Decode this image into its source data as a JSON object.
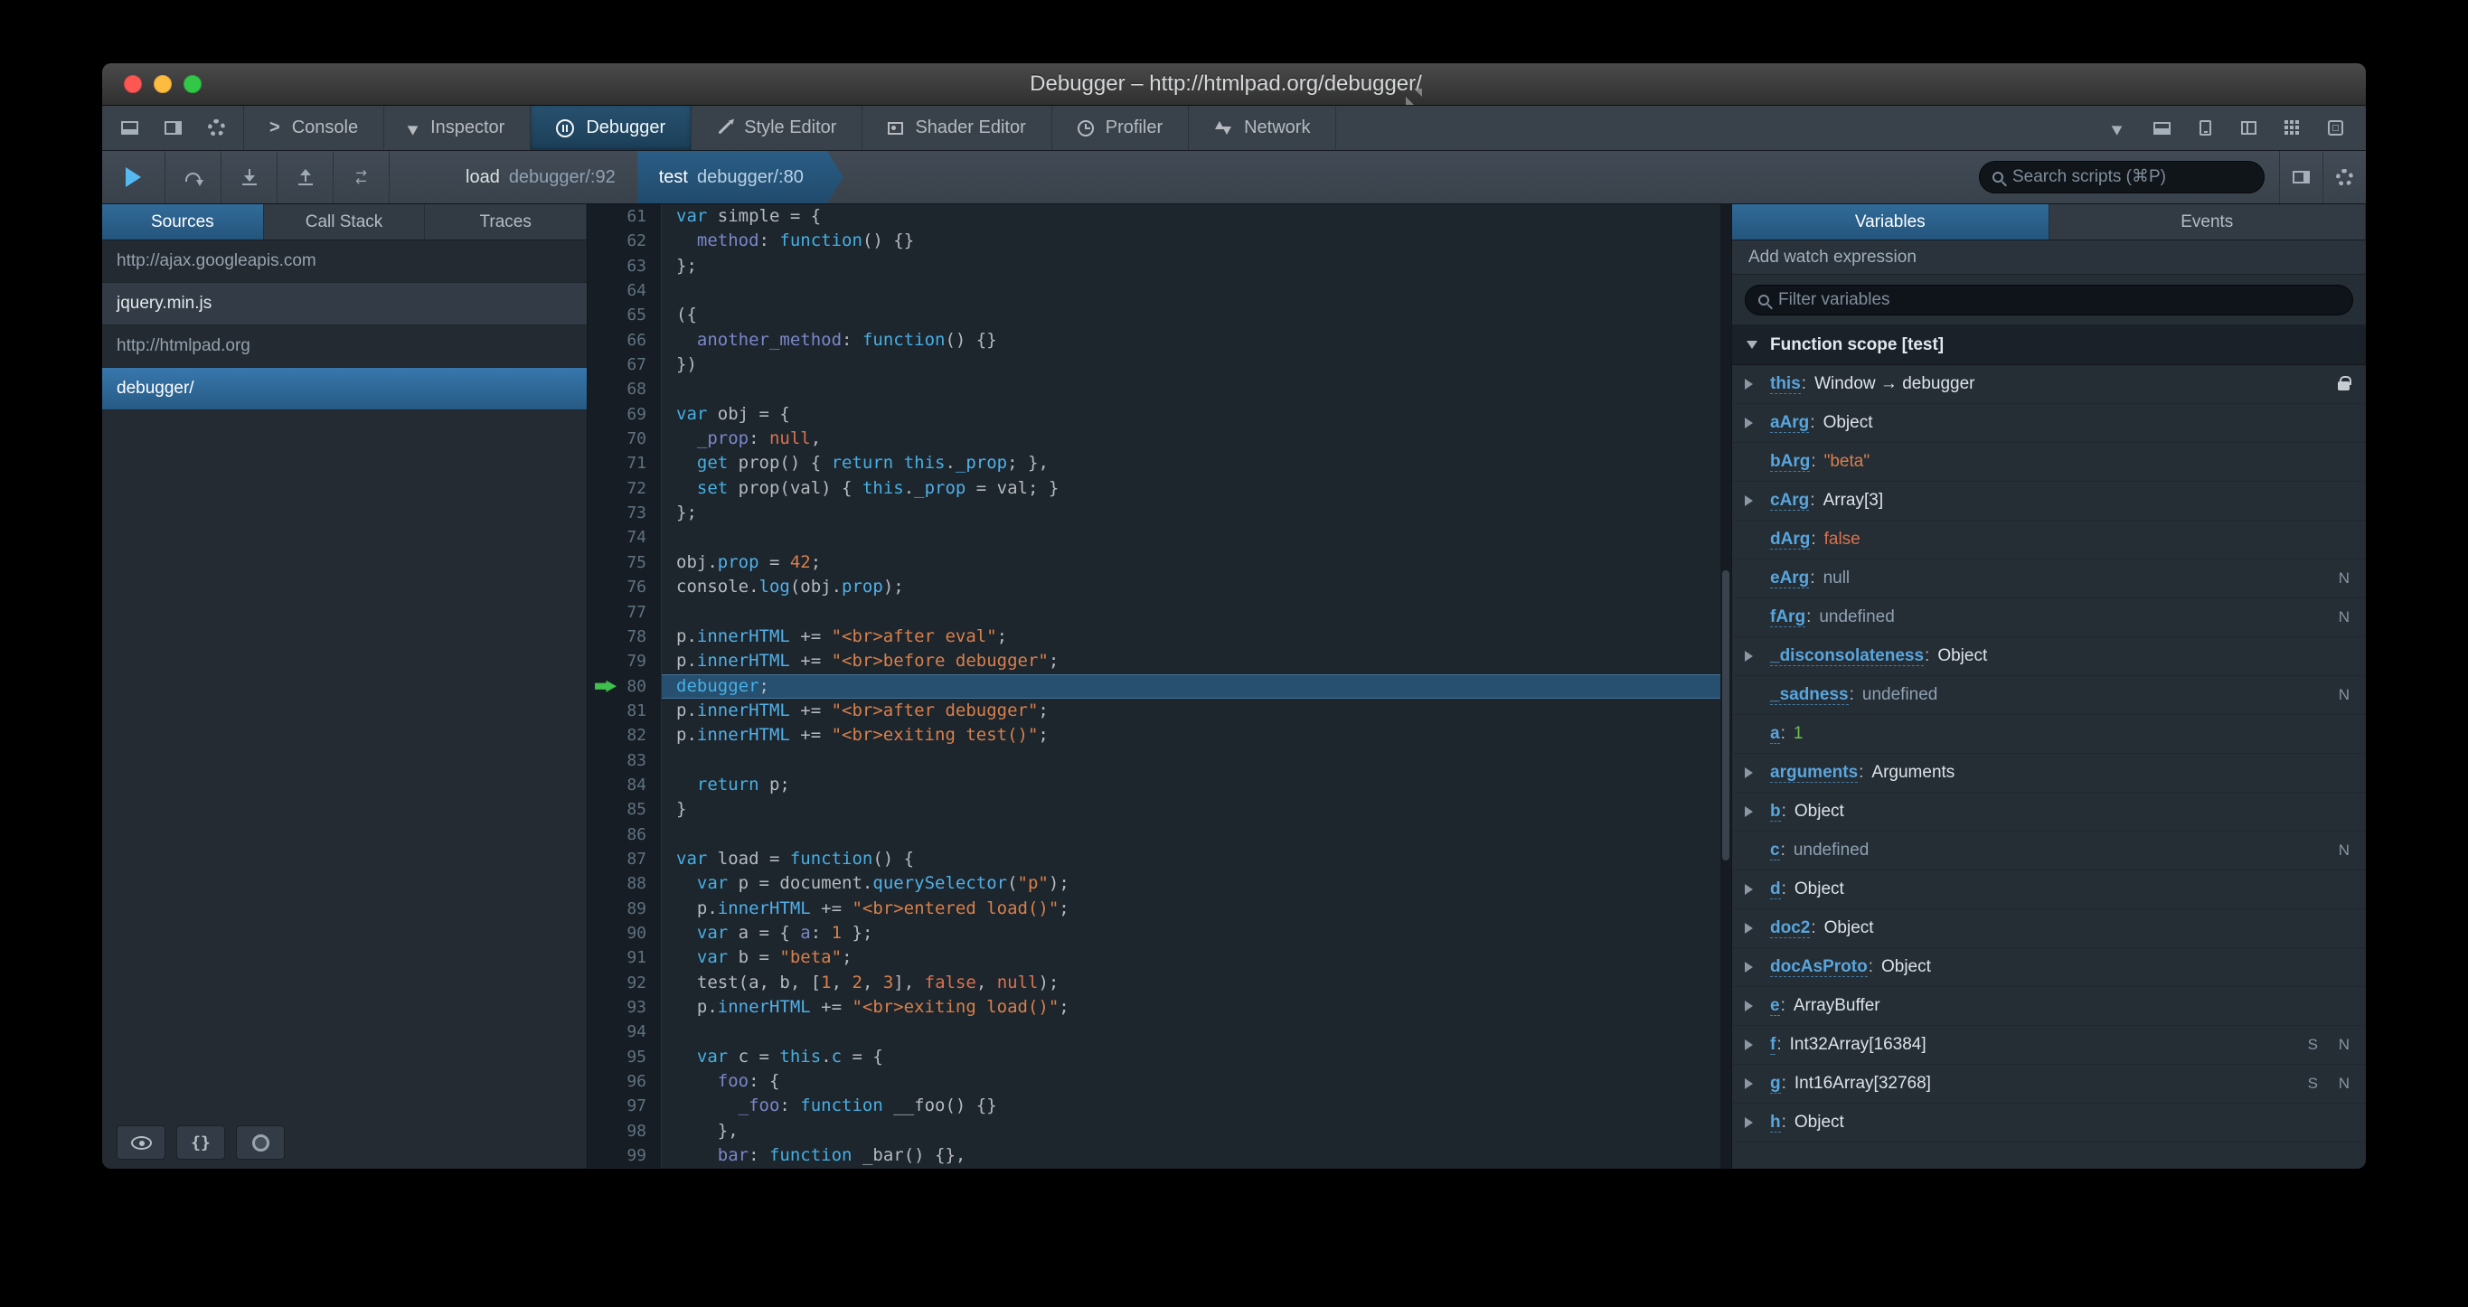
{
  "window": {
    "title": "Debugger – http://htmlpad.org/debugger/"
  },
  "colors": {
    "accent_blue": "#46afe3",
    "selection_blue": "#1d4f73",
    "exec_arrow_green": "#3fbf4e",
    "string_orange": "#d9804a"
  },
  "toolbox": {
    "left_icons": [
      {
        "button": "dock-bottom-button",
        "icon": "dock-bottom"
      },
      {
        "button": "dock-side-button",
        "icon": "dock-side"
      },
      {
        "button": "toolbox-options-button",
        "icon": "gear"
      }
    ],
    "tabs": [
      {
        "label": "Console",
        "icon": "console"
      },
      {
        "label": "Inspector",
        "icon": "inspector"
      },
      {
        "label": "Debugger",
        "icon": "debugger"
      },
      {
        "label": "Style Editor",
        "icon": "style"
      },
      {
        "label": "Shader Editor",
        "icon": "shader"
      },
      {
        "label": "Profiler",
        "icon": "profiler"
      },
      {
        "label": "Network",
        "icon": "network"
      }
    ],
    "active_tab": "Debugger",
    "right_icons": [
      {
        "button": "pick-element-button",
        "icon": "pick-element"
      },
      {
        "button": "split-console-button",
        "icon": "split-console"
      },
      {
        "button": "responsive-mode-button",
        "icon": "responsive-mode"
      },
      {
        "button": "scratchpad-button",
        "icon": "scratchpad"
      },
      {
        "button": "grid-button",
        "icon": "grid"
      },
      {
        "button": "frame-button",
        "icon": "frame"
      }
    ]
  },
  "debugger_toolbar": {
    "left_buttons": [
      {
        "button": "resume-button",
        "icon": "resume"
      },
      {
        "button": "step-over-button",
        "icon": "step-over"
      },
      {
        "button": "step-in-button",
        "icon": "step-in"
      },
      {
        "button": "step-out-button",
        "icon": "step-out"
      },
      {
        "button": "trace-button",
        "icon": "trace"
      }
    ],
    "crumbs": [
      {
        "fn": "load",
        "loc": "debugger/:92",
        "selected": false
      },
      {
        "fn": "test",
        "loc": "debugger/:80",
        "selected": true
      }
    ],
    "search_placeholder": "Search scripts (⌘P)",
    "right_icons": [
      {
        "button": "toggle-panes-button",
        "icon": "toggle-panes"
      },
      {
        "button": "debugger-options-button",
        "icon": "gear"
      }
    ]
  },
  "sources_panel": {
    "tabs": [
      "Sources",
      "Call Stack",
      "Traces"
    ],
    "active_tab": "Sources",
    "items": [
      {
        "label": "http://ajax.googleapis.com",
        "type": "group",
        "selected": false
      },
      {
        "label": "jquery.min.js",
        "type": "file",
        "selected": false
      },
      {
        "label": "http://htmlpad.org",
        "type": "group",
        "selected": false
      },
      {
        "label": "debugger/",
        "type": "file",
        "selected": true
      }
    ],
    "footer_buttons": [
      {
        "button": "toggle-source-visibility-button",
        "icon": "eye"
      },
      {
        "button": "pretty-print-button",
        "icon": "braces"
      },
      {
        "button": "blackbox-source-button",
        "icon": "blackbox"
      }
    ]
  },
  "editor": {
    "current_line": 80,
    "lines": [
      {
        "n": 61,
        "t": [
          [
            "k",
            "var"
          ],
          [
            "d",
            " simple = {"
          ]
        ]
      },
      {
        "n": 62,
        "t": [
          [
            "d",
            "  "
          ],
          [
            "p",
            "method"
          ],
          [
            "d",
            ": "
          ],
          [
            "k",
            "function"
          ],
          [
            "d",
            "() {}"
          ]
        ]
      },
      {
        "n": 63,
        "t": [
          [
            "d",
            "};"
          ]
        ]
      },
      {
        "n": 64,
        "t": []
      },
      {
        "n": 65,
        "t": [
          [
            "d",
            "({"
          ]
        ]
      },
      {
        "n": 66,
        "t": [
          [
            "d",
            "  "
          ],
          [
            "p",
            "another_method"
          ],
          [
            "d",
            ": "
          ],
          [
            "k",
            "function"
          ],
          [
            "d",
            "() {}"
          ]
        ]
      },
      {
        "n": 67,
        "t": [
          [
            "d",
            "})"
          ]
        ]
      },
      {
        "n": 68,
        "t": []
      },
      {
        "n": 69,
        "t": [
          [
            "k",
            "var"
          ],
          [
            "d",
            " obj = {"
          ]
        ]
      },
      {
        "n": 70,
        "t": [
          [
            "d",
            "  "
          ],
          [
            "p",
            "_prop"
          ],
          [
            "d",
            ": "
          ],
          [
            "a",
            "null"
          ],
          [
            "d",
            ","
          ]
        ]
      },
      {
        "n": 71,
        "t": [
          [
            "d",
            "  "
          ],
          [
            "k",
            "get"
          ],
          [
            "d",
            " prop() { "
          ],
          [
            "k",
            "return"
          ],
          [
            "d",
            " "
          ],
          [
            "k",
            "this"
          ],
          [
            "d",
            "."
          ],
          [
            "b",
            "_prop"
          ],
          [
            "d",
            "; },"
          ]
        ]
      },
      {
        "n": 72,
        "t": [
          [
            "d",
            "  "
          ],
          [
            "k",
            "set"
          ],
          [
            "d",
            " prop(val) { "
          ],
          [
            "k",
            "this"
          ],
          [
            "d",
            "."
          ],
          [
            "b",
            "_prop"
          ],
          [
            "d",
            " = val; }"
          ]
        ]
      },
      {
        "n": 73,
        "t": [
          [
            "d",
            "};"
          ]
        ]
      },
      {
        "n": 74,
        "t": []
      },
      {
        "n": 75,
        "t": [
          [
            "d",
            "obj."
          ],
          [
            "b",
            "prop"
          ],
          [
            "d",
            " = "
          ],
          [
            "nm",
            "42"
          ],
          [
            "d",
            ";"
          ]
        ]
      },
      {
        "n": 76,
        "t": [
          [
            "d",
            "console."
          ],
          [
            "b",
            "log"
          ],
          [
            "d",
            "(obj."
          ],
          [
            "b",
            "prop"
          ],
          [
            "d",
            ");"
          ]
        ]
      },
      {
        "n": 77,
        "t": []
      },
      {
        "n": 78,
        "t": [
          [
            "d",
            "p."
          ],
          [
            "b",
            "innerHTML"
          ],
          [
            "d",
            " += "
          ],
          [
            "s",
            "\"<br>after eval\""
          ],
          [
            "d",
            ";"
          ]
        ]
      },
      {
        "n": 79,
        "t": [
          [
            "d",
            "p."
          ],
          [
            "b",
            "innerHTML"
          ],
          [
            "d",
            " += "
          ],
          [
            "s",
            "\"<br>before debugger\""
          ],
          [
            "d",
            ";"
          ]
        ]
      },
      {
        "n": 80,
        "t": [
          [
            "k",
            "debugger"
          ],
          [
            "d",
            ";"
          ]
        ]
      },
      {
        "n": 81,
        "t": [
          [
            "d",
            "p."
          ],
          [
            "b",
            "innerHTML"
          ],
          [
            "d",
            " += "
          ],
          [
            "s",
            "\"<br>after debugger\""
          ],
          [
            "d",
            ";"
          ]
        ]
      },
      {
        "n": 82,
        "t": [
          [
            "d",
            "p."
          ],
          [
            "b",
            "innerHTML"
          ],
          [
            "d",
            " += "
          ],
          [
            "s",
            "\"<br>exiting test()\""
          ],
          [
            "d",
            ";"
          ]
        ]
      },
      {
        "n": 83,
        "t": []
      },
      {
        "n": 84,
        "t": [
          [
            "d",
            "  "
          ],
          [
            "k",
            "return"
          ],
          [
            "d",
            " p;"
          ]
        ]
      },
      {
        "n": 85,
        "t": [
          [
            "d",
            "}"
          ]
        ]
      },
      {
        "n": 86,
        "t": []
      },
      {
        "n": 87,
        "t": [
          [
            "k",
            "var"
          ],
          [
            "d",
            " load = "
          ],
          [
            "k",
            "function"
          ],
          [
            "d",
            "() {"
          ]
        ]
      },
      {
        "n": 88,
        "t": [
          [
            "d",
            "  "
          ],
          [
            "k",
            "var"
          ],
          [
            "d",
            " p = document."
          ],
          [
            "b",
            "querySelector"
          ],
          [
            "d",
            "("
          ],
          [
            "s",
            "\"p\""
          ],
          [
            "d",
            ");"
          ]
        ]
      },
      {
        "n": 89,
        "t": [
          [
            "d",
            "  p."
          ],
          [
            "b",
            "innerHTML"
          ],
          [
            "d",
            " += "
          ],
          [
            "s",
            "\"<br>entered load()\""
          ],
          [
            "d",
            ";"
          ]
        ]
      },
      {
        "n": 90,
        "t": [
          [
            "d",
            "  "
          ],
          [
            "k",
            "var"
          ],
          [
            "d",
            " a = { "
          ],
          [
            "p",
            "a"
          ],
          [
            "d",
            ": "
          ],
          [
            "nm",
            "1"
          ],
          [
            "d",
            " };"
          ]
        ]
      },
      {
        "n": 91,
        "t": [
          [
            "d",
            "  "
          ],
          [
            "k",
            "var"
          ],
          [
            "d",
            " b = "
          ],
          [
            "s",
            "\"beta\""
          ],
          [
            "d",
            ";"
          ]
        ]
      },
      {
        "n": 92,
        "t": [
          [
            "d",
            "  test(a, b, ["
          ],
          [
            "nm",
            "1"
          ],
          [
            "d",
            ", "
          ],
          [
            "nm",
            "2"
          ],
          [
            "d",
            ", "
          ],
          [
            "nm",
            "3"
          ],
          [
            "d",
            "], "
          ],
          [
            "a",
            "false"
          ],
          [
            "d",
            ", "
          ],
          [
            "a",
            "null"
          ],
          [
            "d",
            ");"
          ]
        ]
      },
      {
        "n": 93,
        "t": [
          [
            "d",
            "  p."
          ],
          [
            "b",
            "innerHTML"
          ],
          [
            "d",
            " += "
          ],
          [
            "s",
            "\"<br>exiting load()\""
          ],
          [
            "d",
            ";"
          ]
        ]
      },
      {
        "n": 94,
        "t": []
      },
      {
        "n": 95,
        "t": [
          [
            "d",
            "  "
          ],
          [
            "k",
            "var"
          ],
          [
            "d",
            " c = "
          ],
          [
            "k",
            "this"
          ],
          [
            "d",
            "."
          ],
          [
            "b",
            "c"
          ],
          [
            "d",
            " = {"
          ]
        ]
      },
      {
        "n": 96,
        "t": [
          [
            "d",
            "    "
          ],
          [
            "p",
            "foo"
          ],
          [
            "d",
            ": {"
          ]
        ]
      },
      {
        "n": 97,
        "t": [
          [
            "d",
            "      "
          ],
          [
            "p",
            "_foo"
          ],
          [
            "d",
            ": "
          ],
          [
            "k",
            "function"
          ],
          [
            "d",
            " __foo() {}"
          ]
        ]
      },
      {
        "n": 98,
        "t": [
          [
            "d",
            "    },"
          ]
        ]
      },
      {
        "n": 99,
        "t": [
          [
            "d",
            "    "
          ],
          [
            "p",
            "bar"
          ],
          [
            "d",
            ": "
          ],
          [
            "k",
            "function"
          ],
          [
            "d",
            " _bar() {},"
          ]
        ]
      }
    ]
  },
  "variables_panel": {
    "tabs": [
      "Variables",
      "Events"
    ],
    "active_tab": "Variables",
    "watch_label": "Add watch expression",
    "filter_placeholder": "Filter variables",
    "scope_label": "Function scope [test]",
    "variables": [
      {
        "name": "this",
        "value": "Window → debugger",
        "vclass": "obj",
        "exp": true,
        "lock": true
      },
      {
        "name": "aArg",
        "value": "Object",
        "vclass": "obj",
        "exp": true
      },
      {
        "name": "bArg",
        "value": "\"beta\"",
        "vclass": "str",
        "exp": false
      },
      {
        "name": "cArg",
        "value": "Array[3]",
        "vclass": "obj",
        "exp": true
      },
      {
        "name": "dArg",
        "value": "false",
        "vclass": "bool",
        "exp": false
      },
      {
        "name": "eArg",
        "value": "null",
        "vclass": "dim",
        "exp": false,
        "badge": "N"
      },
      {
        "name": "fArg",
        "value": "undefined",
        "vclass": "dim",
        "exp": false,
        "badge": "N"
      },
      {
        "name": "_disconsolateness",
        "value": "Object",
        "vclass": "obj",
        "exp": true
      },
      {
        "name": "_sadness",
        "value": "undefined",
        "vclass": "dim",
        "exp": false,
        "badge": "N"
      },
      {
        "name": "a",
        "value": "1",
        "vclass": "num",
        "exp": false
      },
      {
        "name": "arguments",
        "value": "Arguments",
        "vclass": "obj",
        "exp": true
      },
      {
        "name": "b",
        "value": "Object",
        "vclass": "obj",
        "exp": true
      },
      {
        "name": "c",
        "value": "undefined",
        "vclass": "dim",
        "exp": false,
        "badge": "N"
      },
      {
        "name": "d",
        "value": "Object",
        "vclass": "obj",
        "exp": true
      },
      {
        "name": "doc2",
        "value": "Object",
        "vclass": "obj",
        "exp": true
      },
      {
        "name": "docAsProto",
        "value": "Object",
        "vclass": "obj",
        "exp": true
      },
      {
        "name": "e",
        "value": "ArrayBuffer",
        "vclass": "obj",
        "exp": true
      },
      {
        "name": "f",
        "value": "Int32Array[16384]",
        "vclass": "obj",
        "exp": true,
        "badge": "S N"
      },
      {
        "name": "g",
        "value": "Int16Array[32768]",
        "vclass": "obj",
        "exp": true,
        "badge": "S N"
      },
      {
        "name": "h",
        "value": "Object",
        "vclass": "obj",
        "exp": true
      }
    ]
  }
}
